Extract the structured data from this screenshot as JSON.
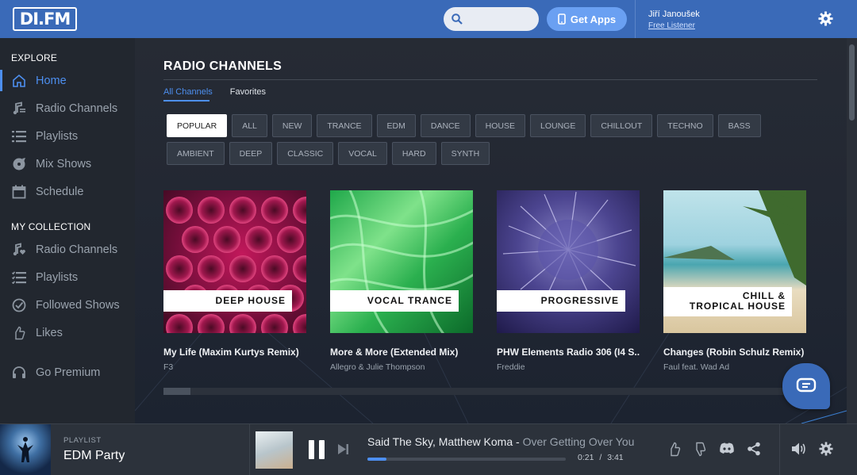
{
  "header": {
    "logo": "DI.FM",
    "search": {
      "placeholder": ""
    },
    "get_apps": "Get Apps",
    "user": {
      "name": "Jiří Janoušek",
      "level": "Free Listener"
    }
  },
  "sidebar": {
    "explore_heading": "EXPLORE",
    "explore": [
      {
        "label": "Home",
        "icon": "home-icon"
      },
      {
        "label": "Radio Channels",
        "icon": "radio-channels-icon"
      },
      {
        "label": "Playlists",
        "icon": "playlists-icon"
      },
      {
        "label": "Mix Shows",
        "icon": "mix-shows-icon"
      },
      {
        "label": "Schedule",
        "icon": "schedule-icon"
      }
    ],
    "collection_heading": "MY COLLECTION",
    "collection": [
      {
        "label": "Radio Channels",
        "icon": "music-note-heart-icon"
      },
      {
        "label": "Playlists",
        "icon": "playlist-check-icon"
      },
      {
        "label": "Followed Shows",
        "icon": "check-circle-icon"
      },
      {
        "label": "Likes",
        "icon": "thumbs-up-icon"
      }
    ],
    "premium": {
      "label": "Go Premium",
      "icon": "headphones-icon"
    }
  },
  "main": {
    "title": "RADIO CHANNELS",
    "tabs": [
      "All Channels",
      "Favorites"
    ],
    "filters": [
      "POPULAR",
      "ALL",
      "NEW",
      "TRANCE",
      "EDM",
      "DANCE",
      "HOUSE",
      "LOUNGE",
      "CHILLOUT",
      "TECHNO",
      "BASS",
      "AMBIENT",
      "DEEP",
      "CLASSIC",
      "VOCAL",
      "HARD",
      "SYNTH"
    ],
    "cards": [
      {
        "channel_line1": "DEEP HOUSE",
        "channel_line2": "",
        "track": "My Life (Maxim Kurtys Remix)",
        "artist": "F3"
      },
      {
        "channel_line1": "VOCAL TRANCE",
        "channel_line2": "",
        "track": "More & More (Extended Mix)",
        "artist": "Allegro & Julie Thompson"
      },
      {
        "channel_line1": "PROGRESSIVE",
        "channel_line2": "",
        "track": "PHW Elements Radio 306 (I4 S...",
        "artist": "Freddie"
      },
      {
        "channel_line1": "CHILL &",
        "channel_line2": "TROPICAL HOUSE",
        "track": "Changes (Robin Schulz Remix)",
        "artist": "Faul feat. Wad Ad"
      }
    ]
  },
  "player": {
    "playlist_label": "PLAYLIST",
    "playlist_name": "EDM Party",
    "artist": "Said The Sky, Matthew Koma",
    "separator": " - ",
    "title": "Over Getting Over You",
    "elapsed": "0:21",
    "time_sep": "/",
    "duration": "3:41",
    "progress": 0.095
  },
  "colors": {
    "brand": "#3a6ab8",
    "accent": "#4d8ff0",
    "sidebar": "#22272f"
  }
}
